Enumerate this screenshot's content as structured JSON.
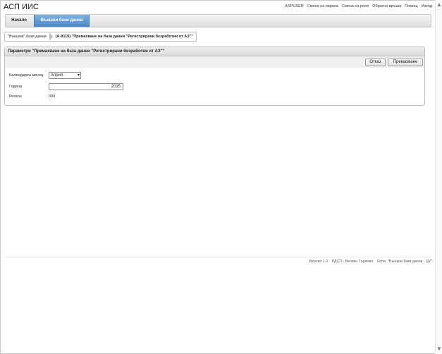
{
  "app": {
    "title": "АСП ИИС"
  },
  "topnav": {
    "user": "ASPUSER",
    "change_password": "Смяна на парола",
    "change_role": "Смяна на роля",
    "feedback": "Обратна връзка",
    "help": "Помощ",
    "logout": "Изход"
  },
  "tabs": {
    "home": "Начало",
    "external": "Външни бази данни"
  },
  "breadcrumb": {
    "root": "\"Външни\" бази данни",
    "current": "(А-9119) \"Премахване на база данни \"Регистрирани безработни от АЗ\"\""
  },
  "panel": {
    "title": "Параметри \"Премахване на база данни \"Регистрирани безработни от АЗ\"\"",
    "buttons": {
      "cancel": "Отказ",
      "remove": "Премахване"
    },
    "fields": {
      "month_label": "Календарен месец",
      "month_value": "Април",
      "year_label": "Година",
      "year_value": "2015",
      "region_label": "Регион",
      "region_value": "000"
    }
  },
  "footer": {
    "version": "Версия 1.0",
    "office": "РДСП - Велико Търново",
    "role": "Роля: \"Външни бази данни - ЦУ\""
  }
}
